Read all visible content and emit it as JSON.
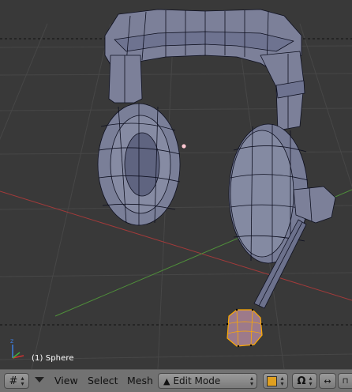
{
  "viewport": {
    "overlay_text": "(1) Sphere",
    "object_name": "Sphere",
    "background_color": "#393939",
    "grid_color": "#474747",
    "x_axis_color": "#a23a3a",
    "y_axis_color": "#4f8f3a",
    "mesh_fill": "#7a7f98",
    "mesh_wire": "#0e1020",
    "selection_color": "#ffaa00"
  },
  "header": {
    "view_menu": "View",
    "select_menu": "Select",
    "mesh_menu": "Mesh",
    "mode": "Edit Mode",
    "icons": [
      "grid-editor-icon",
      "collapse-triangle-icon",
      "mode-triangle-icon",
      "shading-cube-icon",
      "pivot-icon",
      "magnet-icon",
      "manipulator-icon"
    ]
  }
}
